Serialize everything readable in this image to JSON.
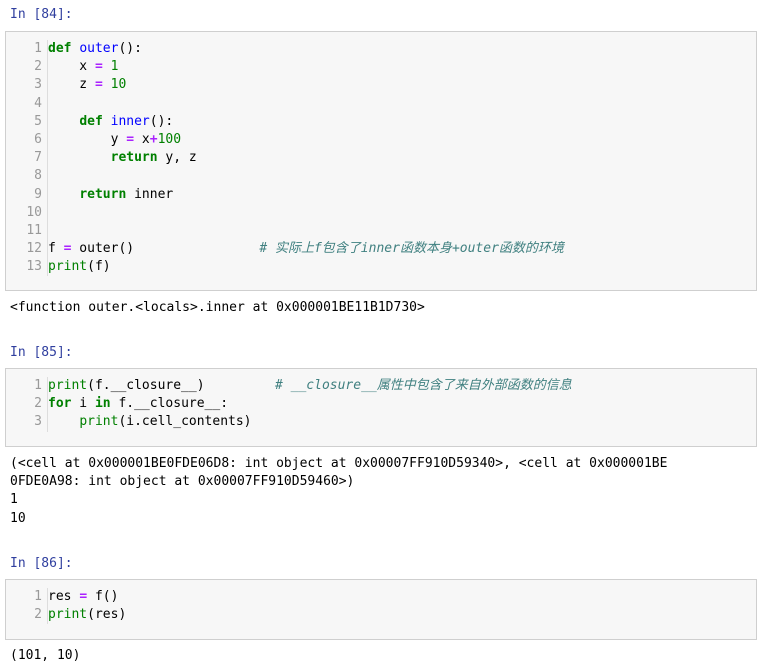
{
  "cells": [
    {
      "prompt": "In  [84]:",
      "lines": [
        [
          {
            "t": "kw",
            "v": "def"
          },
          {
            "t": "nm",
            "v": " "
          },
          {
            "t": "fn",
            "v": "outer"
          },
          {
            "t": "nm",
            "v": "():"
          }
        ],
        [
          {
            "t": "nm",
            "v": "    x "
          },
          {
            "t": "op",
            "v": "="
          },
          {
            "t": "nm",
            "v": " "
          },
          {
            "t": "num",
            "v": "1"
          }
        ],
        [
          {
            "t": "nm",
            "v": "    z "
          },
          {
            "t": "op",
            "v": "="
          },
          {
            "t": "nm",
            "v": " "
          },
          {
            "t": "num",
            "v": "10"
          }
        ],
        [],
        [
          {
            "t": "nm",
            "v": "    "
          },
          {
            "t": "kw",
            "v": "def"
          },
          {
            "t": "nm",
            "v": " "
          },
          {
            "t": "fn",
            "v": "inner"
          },
          {
            "t": "nm",
            "v": "():"
          }
        ],
        [
          {
            "t": "nm",
            "v": "        y "
          },
          {
            "t": "op",
            "v": "="
          },
          {
            "t": "nm",
            "v": " x"
          },
          {
            "t": "op",
            "v": "+"
          },
          {
            "t": "num",
            "v": "100"
          }
        ],
        [
          {
            "t": "nm",
            "v": "        "
          },
          {
            "t": "kw",
            "v": "return"
          },
          {
            "t": "nm",
            "v": " y, z"
          }
        ],
        [],
        [
          {
            "t": "nm",
            "v": "    "
          },
          {
            "t": "kw",
            "v": "return"
          },
          {
            "t": "nm",
            "v": " inner"
          }
        ],
        [],
        [],
        [
          {
            "t": "nm",
            "v": "f "
          },
          {
            "t": "op",
            "v": "="
          },
          {
            "t": "nm",
            "v": " outer()                "
          },
          {
            "t": "cm",
            "v": "# 实际上f包含了inner函数本身+outer函数的环境"
          }
        ],
        [
          {
            "t": "bi",
            "v": "print"
          },
          {
            "t": "nm",
            "v": "(f)"
          }
        ]
      ],
      "output": "<function outer.<locals>.inner at 0x000001BE11B1D730>"
    },
    {
      "prompt": "In  [85]:",
      "lines": [
        [
          {
            "t": "bi",
            "v": "print"
          },
          {
            "t": "nm",
            "v": "(f.__closure__)         "
          },
          {
            "t": "cm",
            "v": "# __closure__属性中包含了来自外部函数的信息"
          }
        ],
        [
          {
            "t": "kw",
            "v": "for"
          },
          {
            "t": "nm",
            "v": " i "
          },
          {
            "t": "kw",
            "v": "in"
          },
          {
            "t": "nm",
            "v": " f.__closure__:"
          }
        ],
        [
          {
            "t": "nm",
            "v": "    "
          },
          {
            "t": "bi",
            "v": "print"
          },
          {
            "t": "nm",
            "v": "(i.cell_contents)"
          }
        ]
      ],
      "output": "(<cell at 0x000001BE0FDE06D8: int object at 0x00007FF910D59340>, <cell at 0x000001BE\n0FDE0A98: int object at 0x00007FF910D59460>)\n1\n10"
    },
    {
      "prompt": "In  [86]:",
      "lines": [
        [
          {
            "t": "nm",
            "v": "res "
          },
          {
            "t": "op",
            "v": "="
          },
          {
            "t": "nm",
            "v": " f()"
          }
        ],
        [
          {
            "t": "bi",
            "v": "print"
          },
          {
            "t": "nm",
            "v": "(res)"
          }
        ]
      ],
      "output": "(101, 10)"
    }
  ]
}
